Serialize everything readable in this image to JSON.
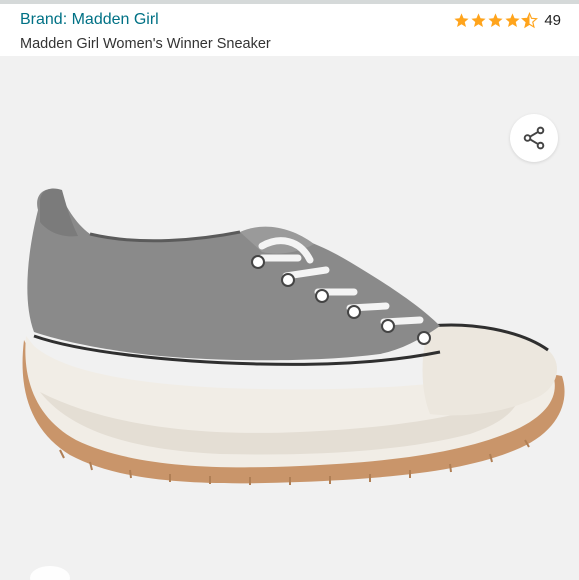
{
  "header": {
    "brand_label": "Brand: Madden Girl",
    "product_title": "Madden Girl Women's Winner Sneaker",
    "rating": {
      "stars": 4.5,
      "max_stars": 5,
      "review_count": "49"
    }
  },
  "colors": {
    "brand_link": "#007185",
    "star": "#ffa41c",
    "image_background": "#f1f1f1"
  },
  "icons": {
    "share": "share-icon"
  }
}
